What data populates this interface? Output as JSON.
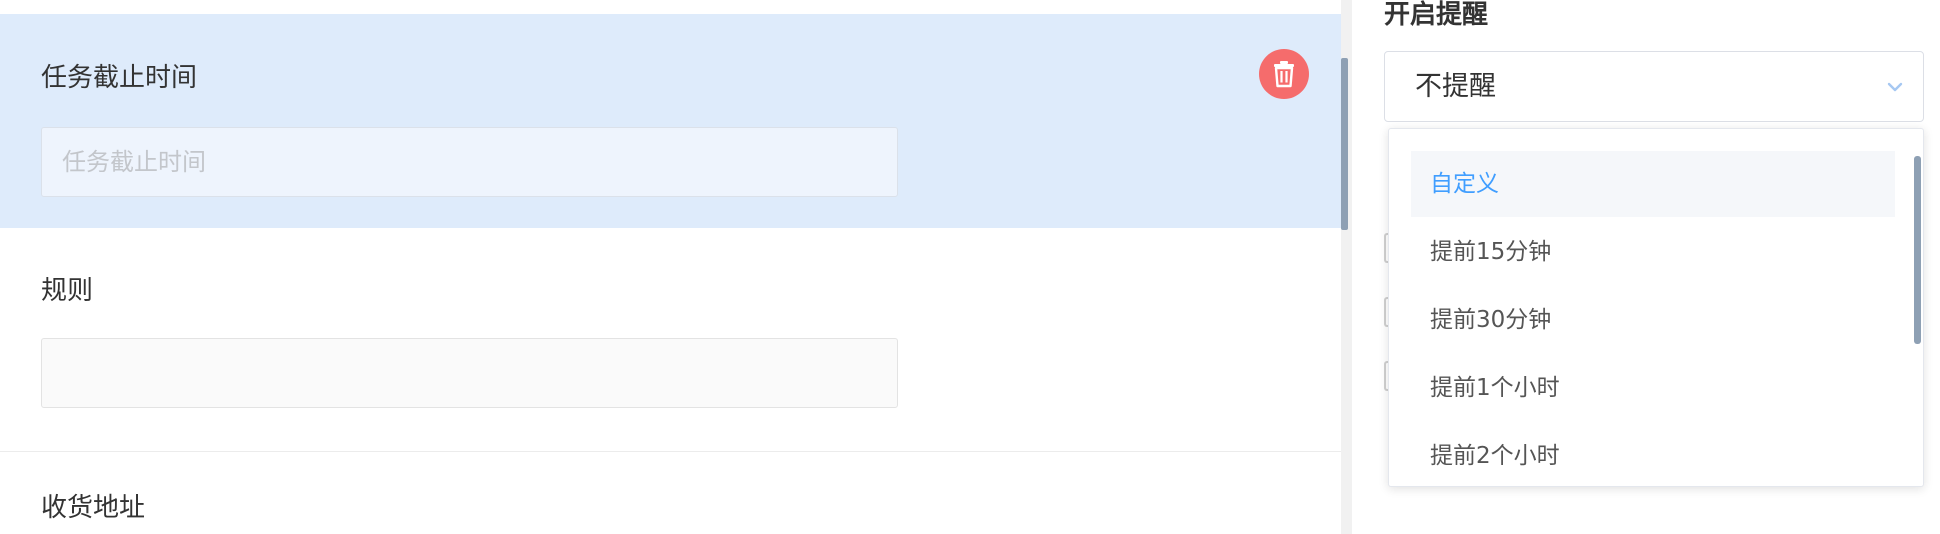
{
  "form": {
    "deadline_field": {
      "label": "任务截止时间",
      "placeholder": "任务截止时间"
    },
    "rules_field": {
      "label": "规则",
      "value": ""
    },
    "address_field": {
      "label": "收货地址"
    }
  },
  "settings": {
    "reminder_title": "开启提醒",
    "reminder_select": {
      "value": "不提醒",
      "options": [
        {
          "label": "自定义"
        },
        {
          "label": "提前15分钟"
        },
        {
          "label": "提前30分钟"
        },
        {
          "label": "提前1个小时"
        },
        {
          "label": "提前2个小时"
        }
      ]
    }
  },
  "colors": {
    "selected_field_bg": "#deebfb",
    "delete_button": "#f56c6c",
    "active_option": "#409eff",
    "scrollbar": "#8ea0b4"
  },
  "icons": {
    "delete": "trash-icon",
    "select_arrow": "chevron-down-icon"
  }
}
